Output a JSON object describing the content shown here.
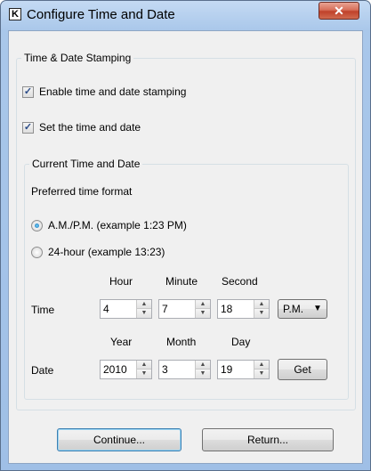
{
  "window": {
    "title": "Configure Time and Date",
    "icon_letter": "K",
    "close_glyph": "✕"
  },
  "stamping_group": {
    "legend": "Time & Date Stamping",
    "enable_checkbox": {
      "label": "Enable time and date stamping",
      "checked": true
    },
    "set_checkbox": {
      "label": "Set the time and date",
      "checked": true
    }
  },
  "current_group": {
    "legend": "Current Time and Date",
    "preferred_format_label": "Preferred time format",
    "format_options": [
      {
        "label": "A.M./P.M. (example 1:23 PM)",
        "selected": true
      },
      {
        "label": "24-hour (example 13:23)",
        "selected": false
      }
    ],
    "time_row": {
      "row_label": "Time",
      "headers": [
        "Hour",
        "Minute",
        "Second"
      ],
      "hour": "4",
      "minute": "7",
      "second": "18",
      "ampm": "P.M."
    },
    "date_row": {
      "row_label": "Date",
      "headers": [
        "Year",
        "Month",
        "Day"
      ],
      "year": "2010",
      "month": "3",
      "day": "19",
      "get_button": "Get"
    }
  },
  "footer": {
    "continue_button": "Continue...",
    "return_button": "Return..."
  },
  "icons": {
    "check": "✓",
    "spin_up": "▲",
    "spin_down": "▼",
    "dropdown": "▼"
  }
}
